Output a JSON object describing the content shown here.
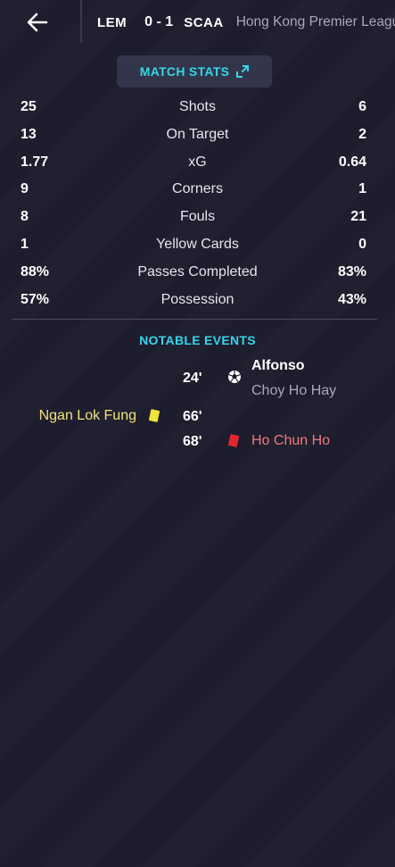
{
  "header": {
    "home_team": "LEM",
    "score": "0 - 1",
    "away_team": "SCAA",
    "competition": "Hong Kong Premier League"
  },
  "match_stats_button": {
    "label": "MATCH STATS",
    "icon": "expand-icon"
  },
  "stats": [
    {
      "home": "25",
      "label": "Shots",
      "away": "6"
    },
    {
      "home": "13",
      "label": "On Target",
      "away": "2"
    },
    {
      "home": "1.77",
      "label": "xG",
      "away": "0.64"
    },
    {
      "home": "9",
      "label": "Corners",
      "away": "1"
    },
    {
      "home": "8",
      "label": "Fouls",
      "away": "21"
    },
    {
      "home": "1",
      "label": "Yellow Cards",
      "away": "0"
    },
    {
      "home": "88%",
      "label": "Passes Completed",
      "away": "83%"
    },
    {
      "home": "57%",
      "label": "Possession",
      "away": "43%"
    }
  ],
  "notable_events": {
    "title": "NOTABLE EVENTS",
    "events": [
      {
        "minute": "24'",
        "type": "goal",
        "icon": "football-icon",
        "player": "Alfonso",
        "assist": "Choy Ho Hay",
        "side": "away"
      },
      {
        "minute": "66'",
        "type": "yellow-card",
        "icon": "yellow-card-icon",
        "player": "Ngan Lok Fung",
        "side": "home"
      },
      {
        "minute": "68'",
        "type": "red-card",
        "icon": "red-card-icon",
        "player": "Ho Chun Ho",
        "side": "away"
      }
    ]
  },
  "colors": {
    "accent": "#35d6ea",
    "background": "#1d1d2e",
    "yellow_card": "#f2e23a",
    "red_card": "#e3262e"
  }
}
